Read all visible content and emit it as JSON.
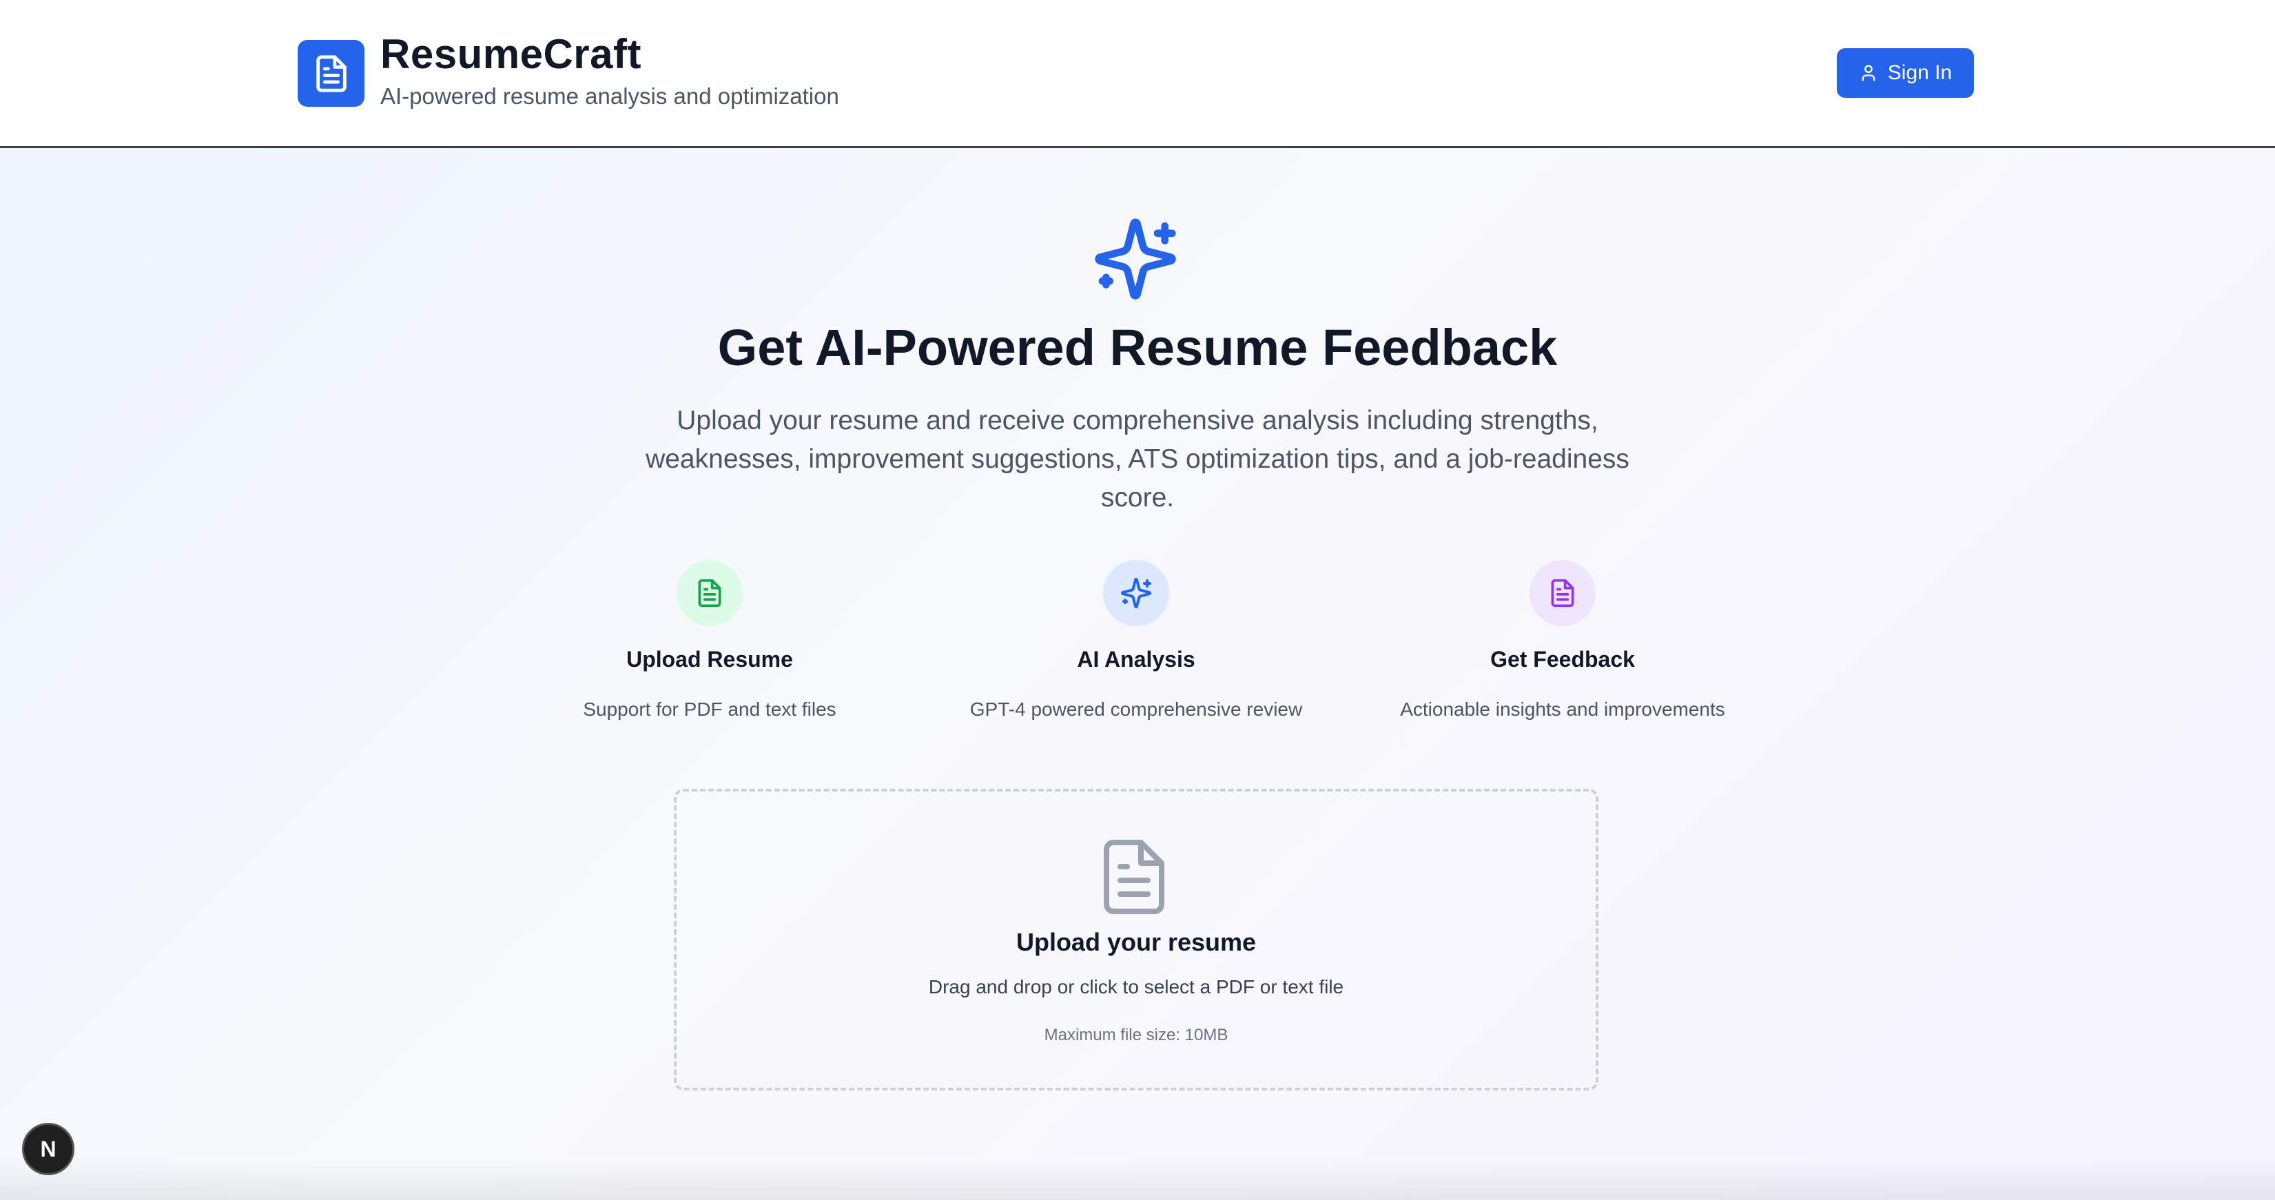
{
  "header": {
    "app_title": "ResumeCraft",
    "app_subtitle": "AI-powered resume analysis and optimization",
    "signin_label": "Sign In",
    "logo_icon": "document-icon",
    "brand_color": "#2563eb"
  },
  "hero": {
    "icon": "sparkles-icon",
    "title": "Get AI-Powered Resume Feedback",
    "description": "Upload your resume and receive comprehensive analysis including strengths, weaknesses, improvement suggestions, ATS optimization tips, and a job-readiness score."
  },
  "features": [
    {
      "icon": "document-icon",
      "color": "#16a34a",
      "title": "Upload Resume",
      "description": "Support for PDF and text files"
    },
    {
      "icon": "sparkles-icon",
      "color": "#2563eb",
      "title": "AI Analysis",
      "description": "GPT-4 powered comprehensive review"
    },
    {
      "icon": "document-icon",
      "color": "#9333ea",
      "title": "Get Feedback",
      "description": "Actionable insights and improvements"
    }
  ],
  "upload": {
    "icon": "document-icon",
    "title": "Upload your resume",
    "description": "Drag and drop or click to select a PDF or text file",
    "note": "Maximum file size: 10MB"
  },
  "dev_badge": {
    "label": "N"
  }
}
